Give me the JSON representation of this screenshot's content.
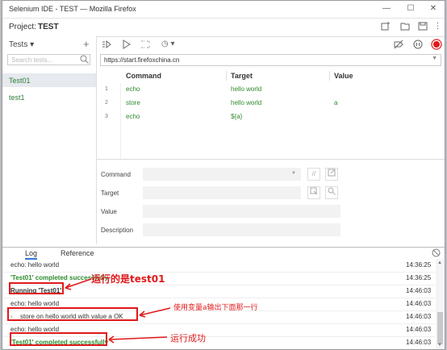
{
  "window": {
    "title": "Selenium IDE - TEST — Mozilla Firefox",
    "controls": [
      "—",
      "☐",
      "✕"
    ]
  },
  "project": {
    "label": "Project:",
    "name": "TEST"
  },
  "sidebar": {
    "dropdown_label": "Tests ▾",
    "add_label": "+",
    "search_placeholder": "Search tests...",
    "tests": [
      "Test01",
      "test1"
    ]
  },
  "toolbar": {
    "speed_label": "◷ ▾"
  },
  "url": {
    "value": "https://start.firefoxchina.cn"
  },
  "grid": {
    "headers": {
      "command": "Command",
      "target": "Target",
      "value": "Value"
    },
    "rows": [
      {
        "num": "1",
        "command": "echo",
        "target": "hello world",
        "value": ""
      },
      {
        "num": "2",
        "command": "store",
        "target": "hello world",
        "value": "a"
      },
      {
        "num": "3",
        "command": "echo",
        "target": "${a}",
        "value": ""
      }
    ]
  },
  "form": {
    "command_label": "Command",
    "target_label": "Target",
    "value_label": "Value",
    "description_label": "Description"
  },
  "log": {
    "tabs": [
      "Log",
      "Reference"
    ],
    "entries": [
      {
        "message": "echo: hello world",
        "time": "14:36:25",
        "kind": "info"
      },
      {
        "message": "'Test01' completed successfully",
        "time": "14:36:25",
        "kind": "ok"
      },
      {
        "message": "Running 'Test01'",
        "time": "14:46:03",
        "kind": "run"
      },
      {
        "message": "echo: hello world",
        "time": "14:46:03",
        "kind": "info"
      },
      {
        "message": "store on hello world with value a OK",
        "time": "14:46:03",
        "kind": "info"
      },
      {
        "message": "echo: hello world",
        "time": "14:46:03",
        "kind": "info"
      },
      {
        "message": "'Test01' completed successfully",
        "time": "14:46:03",
        "kind": "ok"
      }
    ]
  },
  "annotations": {
    "running_note": "运行的是test01",
    "store_note": "使用变量a输出下面那一行",
    "success_note": "运行成功"
  },
  "colors": {
    "accent_red": "#e0191b",
    "command_green": "#2d8a2d",
    "tab_blue": "#2f78d6"
  }
}
